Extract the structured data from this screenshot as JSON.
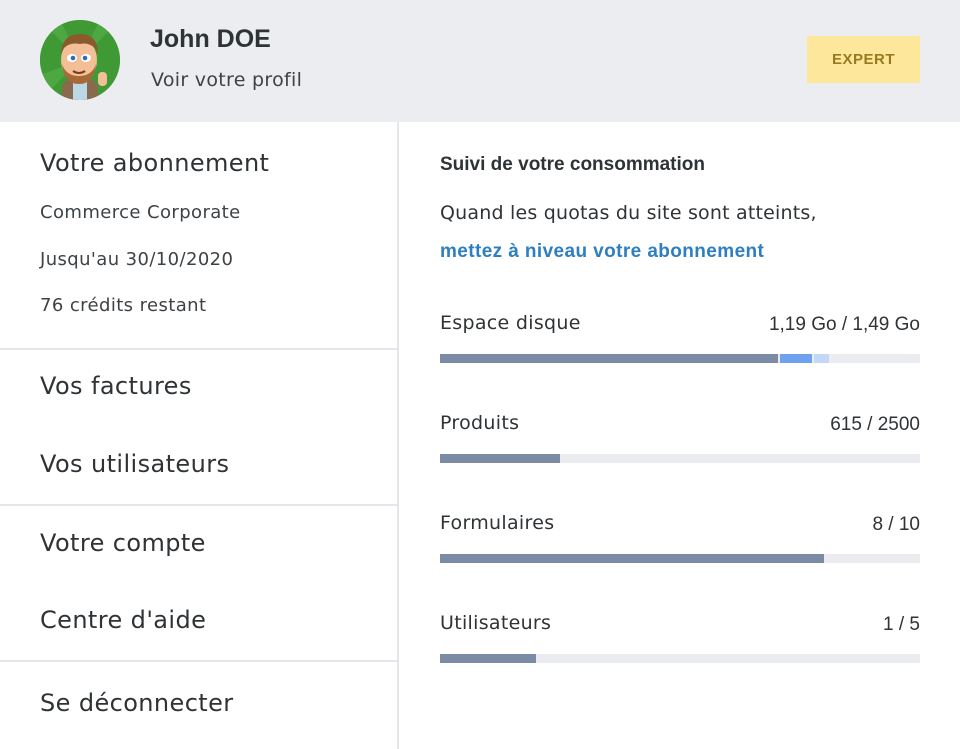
{
  "header": {
    "user_name": "John DOE",
    "profile_link": "Voir votre profil",
    "badge": "EXPERT"
  },
  "subscription": {
    "title": "Votre abonnement",
    "plan": "Commerce Corporate",
    "until": "Jusqu'au 30/10/2020",
    "credits": "76 crédits restant"
  },
  "menu": {
    "invoices": "Vos factures",
    "users": "Vos utilisateurs",
    "account": "Votre compte",
    "help": "Centre d'aide",
    "logout": "Se déconnecter"
  },
  "usage": {
    "title": "Suivi de votre consommation",
    "text": "Quand les quotas du site sont atteints,",
    "upgrade_link": "mettez à niveau votre abonnement",
    "metrics": [
      {
        "label": "Espace disque",
        "value": "1,19 Go / 1,49 Go",
        "fill": 0.705,
        "color": "#7b8aa5",
        "extra": [
          {
            "fill": 0.07,
            "color": "#6ea1ef"
          },
          {
            "fill": 0.035,
            "color": "#c3d8f6"
          }
        ]
      },
      {
        "label": "Produits",
        "value": "615 / 2500",
        "fill": 0.25,
        "color": "#7b8aa5"
      },
      {
        "label": "Formulaires",
        "value": "8 / 10",
        "fill": 0.8,
        "color": "#7b8aa5"
      },
      {
        "label": "Utilisateurs",
        "value": "1 / 5",
        "fill": 0.2,
        "color": "#7b8aa5"
      }
    ]
  }
}
